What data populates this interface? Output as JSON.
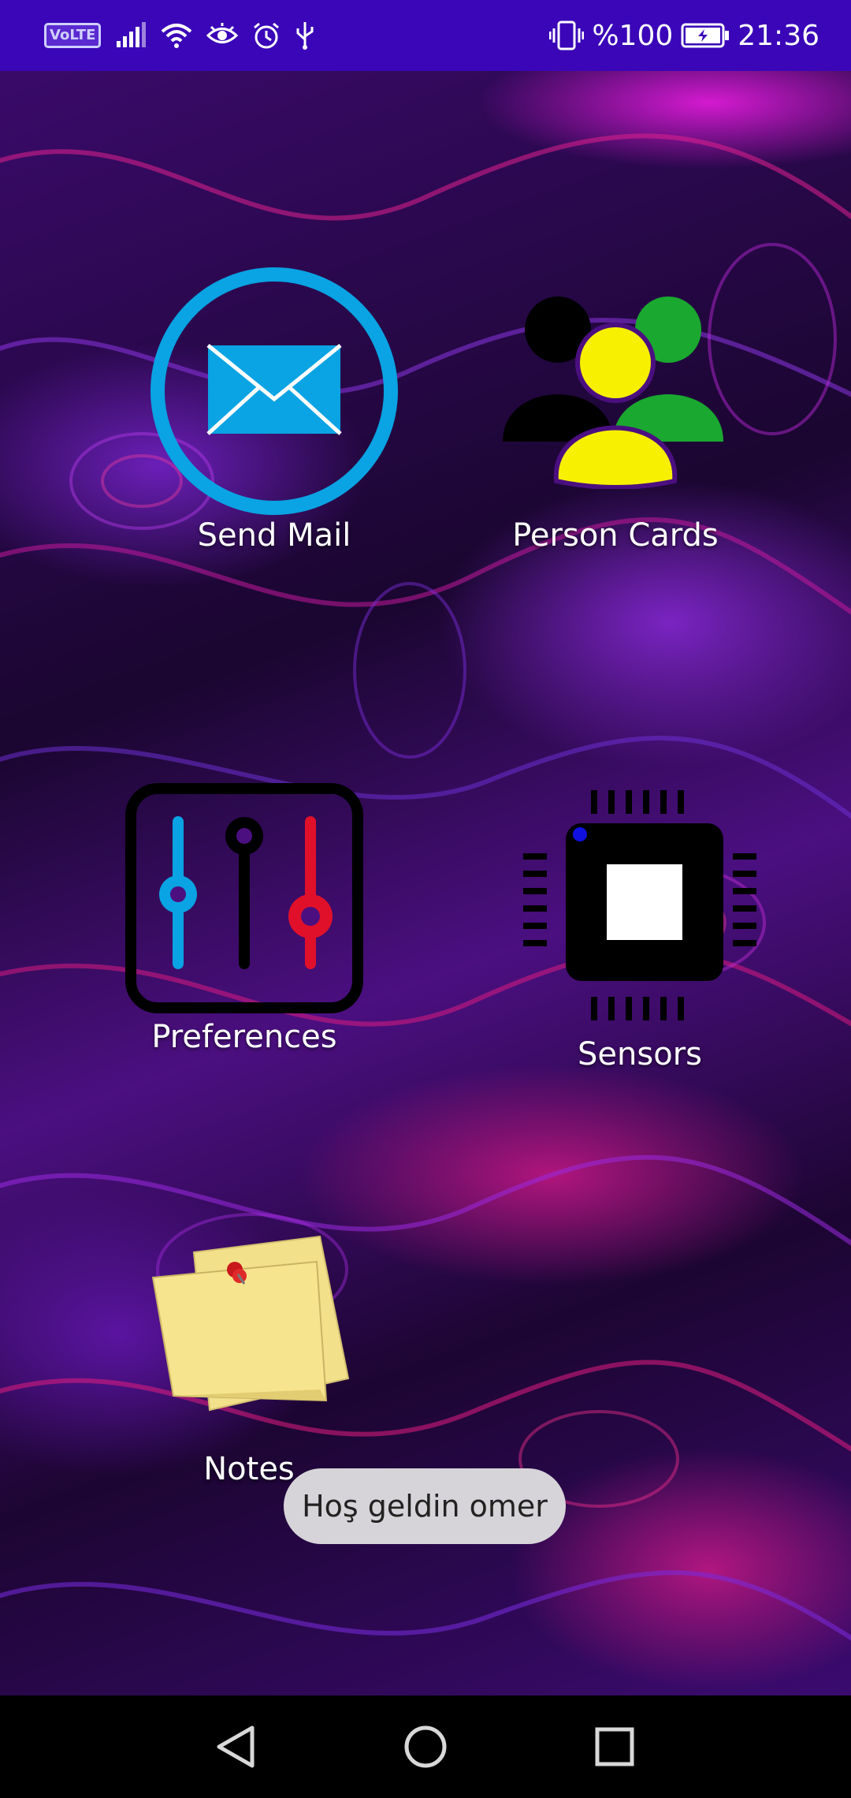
{
  "status_bar": {
    "volte": "VoLTE",
    "battery_percent": "%100",
    "time": "21:36",
    "icons": [
      "volte-icon",
      "signal-icon",
      "wifi-icon",
      "eye-icon",
      "alarm-icon",
      "usb-icon",
      "vibrate-icon",
      "battery-icon"
    ]
  },
  "apps": [
    {
      "id": "send-mail",
      "label": "Send Mail",
      "icon": "mail-icon"
    },
    {
      "id": "person-cards",
      "label": "Person Cards",
      "icon": "people-icon"
    },
    {
      "id": "preferences",
      "label": "Preferences",
      "icon": "sliders-icon"
    },
    {
      "id": "sensors",
      "label": "Sensors",
      "icon": "chip-icon"
    },
    {
      "id": "notes",
      "label": "Notes",
      "icon": "sticky-notes-icon"
    }
  ],
  "toast": {
    "text": "Hoş geldin omer"
  },
  "nav_bar": {
    "icons": [
      "back-icon",
      "home-icon",
      "recents-icon"
    ]
  },
  "colors": {
    "status_bar": "#3a06b8",
    "mail_blue": "#0aa3e3",
    "people_yellow": "#f7f000",
    "people_green": "#1aa830",
    "slider_blue": "#0aa3e3",
    "slider_red": "#e0102a"
  }
}
